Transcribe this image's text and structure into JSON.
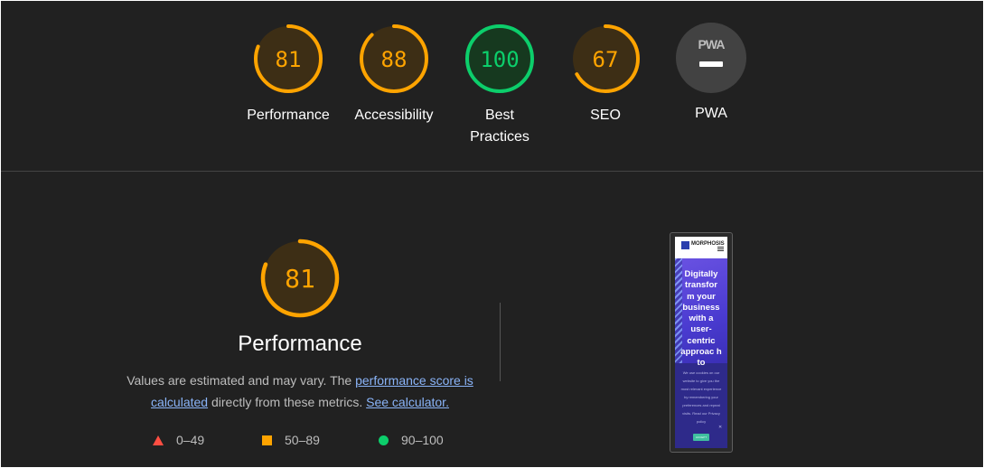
{
  "scores": [
    {
      "name": "Performance",
      "value": 81,
      "color": "#ffa400",
      "track": "#3d2e15"
    },
    {
      "name": "Accessibility",
      "value": 88,
      "color": "#ffa400",
      "track": "#3d2e15"
    },
    {
      "name_line1": "Best",
      "name_line2": "Practices",
      "value": 100,
      "color": "#0cce6b",
      "track": "#16391f"
    },
    {
      "name": "SEO",
      "value": 67,
      "color": "#ffa400",
      "track": "#3d2e15"
    },
    {
      "name": "PWA",
      "badge": "PWA",
      "color": "#424242"
    }
  ],
  "performance": {
    "score": 81,
    "title": "Performance",
    "desc_pre": "Values are estimated and may vary. The ",
    "desc_link1": "performance score is calculated",
    "desc_mid": " directly from these metrics. ",
    "desc_link2": "See calculator."
  },
  "legend": [
    {
      "range": "0–49",
      "color": "#ff4e42",
      "shape": "triangle"
    },
    {
      "range": "50–89",
      "color": "#ffa400",
      "shape": "square"
    },
    {
      "range": "90–100",
      "color": "#0cce6b",
      "shape": "circle"
    }
  ],
  "screenshot": {
    "brand": "MORPHOSIS",
    "headline": "Digitally transfor m your business with a user- centric approac h to",
    "cookie_text": "We use cookies on our website to give you the most relevant experience by remembering your preferences and repeat visits. Read our Privacy policy",
    "close": "✕",
    "button": "ACCEPT"
  }
}
